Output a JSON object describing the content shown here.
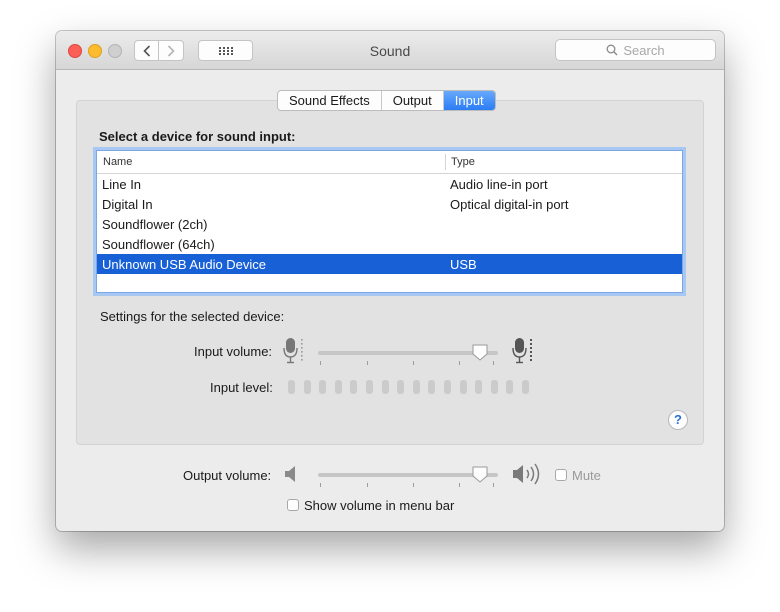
{
  "window": {
    "title": "Sound"
  },
  "toolbar": {
    "search_placeholder": "Search"
  },
  "tabs": [
    {
      "label": "Sound Effects",
      "active": false
    },
    {
      "label": "Output",
      "active": false
    },
    {
      "label": "Input",
      "active": true
    }
  ],
  "input_panel": {
    "heading": "Select a device for sound input:",
    "columns": {
      "name": "Name",
      "type": "Type"
    },
    "devices": [
      {
        "name": "Line In",
        "type": "Audio line-in port"
      },
      {
        "name": "Digital In",
        "type": "Optical digital-in port"
      },
      {
        "name": "Soundflower (2ch)",
        "type": ""
      },
      {
        "name": "Soundflower (64ch)",
        "type": ""
      },
      {
        "name": "Unknown USB Audio Device",
        "type": "USB",
        "selected": true
      }
    ],
    "settings_label": "Settings for the selected device:",
    "input_volume_label": "Input volume:",
    "input_volume_level": 0.9,
    "input_level_label": "Input level:",
    "input_level_value": 0,
    "help_label": "?"
  },
  "output": {
    "output_volume_label": "Output volume:",
    "output_volume_level": 0.9,
    "mute_label": "Mute",
    "mute_checked": false,
    "show_volume_label": "Show volume in menu bar",
    "show_volume_checked": false
  },
  "colors": {
    "selection": "#1860d6",
    "accent": "#2b7cf5"
  },
  "icons": [
    "back-chevron-icon",
    "forward-chevron-icon",
    "grid-icon",
    "search-icon",
    "mic-low-icon",
    "mic-high-icon",
    "speaker-low-icon",
    "speaker-high-icon",
    "help-icon"
  ]
}
